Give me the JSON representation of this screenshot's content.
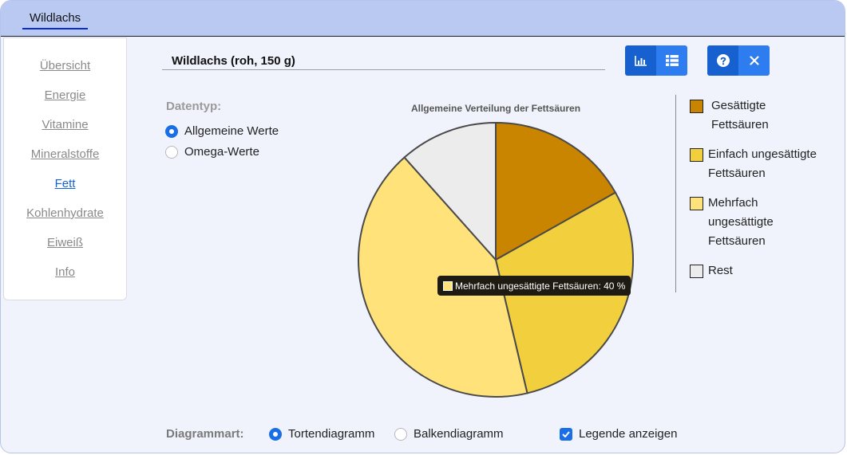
{
  "top_tab": "Wildlachs",
  "sidebar": {
    "items": [
      {
        "label": "Übersicht",
        "active": false
      },
      {
        "label": "Energie",
        "active": false
      },
      {
        "label": "Vitamine",
        "active": false
      },
      {
        "label": "Mineralstoffe",
        "active": false
      },
      {
        "label": "Fett",
        "active": true
      },
      {
        "label": "Kohlenhydrate",
        "active": false
      },
      {
        "label": "Eiweiß",
        "active": false
      },
      {
        "label": "Info",
        "active": false
      }
    ]
  },
  "food_title": "Wildlachs (roh, 150 g)",
  "toolbar": {
    "chart_view_icon": "bar-chart-icon",
    "table_view_icon": "list-icon",
    "help_icon": "help-icon",
    "close_icon": "close-icon"
  },
  "datatype": {
    "label": "Datentyp:",
    "options": [
      {
        "label": "Allgemeine Werte",
        "selected": true
      },
      {
        "label": "Omega-Werte",
        "selected": false
      }
    ]
  },
  "chart_data": {
    "type": "pie",
    "title": "Allgemeine Verteilung der Fettsäuren",
    "slices": [
      {
        "label": "Gesättigte Fettsäuren",
        "value": 16,
        "color": "#c98400"
      },
      {
        "label": "Einfach ungesättigte Fettsäuren",
        "value": 28,
        "color": "#f2cf3d"
      },
      {
        "label": "Mehrfach ungesättigte Fettsäuren",
        "value": 40,
        "color": "#ffe27a"
      },
      {
        "label": "Rest",
        "value": 11,
        "color": "#ececec"
      }
    ],
    "legend": {
      "placement": "right",
      "items": [
        {
          "label_lines": [
            "Gesättigte",
            "Fettsäuren"
          ],
          "color": "#c98400"
        },
        {
          "label_lines": [
            "Einfach ungesättigte",
            "Fettsäuren"
          ],
          "color": "#f2cf3d"
        },
        {
          "label_lines": [
            "Mehrfach",
            "ungesättigte",
            "Fettsäuren"
          ],
          "color": "#ffe27a"
        },
        {
          "label_lines": [
            "Rest"
          ],
          "color": "#ececec"
        }
      ]
    },
    "tooltip": "Mehrfach ungesättigte Fettsäuren: 40 %"
  },
  "bottom": {
    "diagram_label": "Diagrammart:",
    "pie_option": {
      "label": "Tortendiagramm",
      "selected": true
    },
    "bar_option": {
      "label": "Balkendiagramm",
      "selected": false
    },
    "legend_toggle": {
      "label": "Legende anzeigen",
      "checked": true
    }
  },
  "colors": {
    "accent": "#1a6fe6",
    "topbar": "#b9c9f2",
    "background": "#f0f3fc"
  }
}
